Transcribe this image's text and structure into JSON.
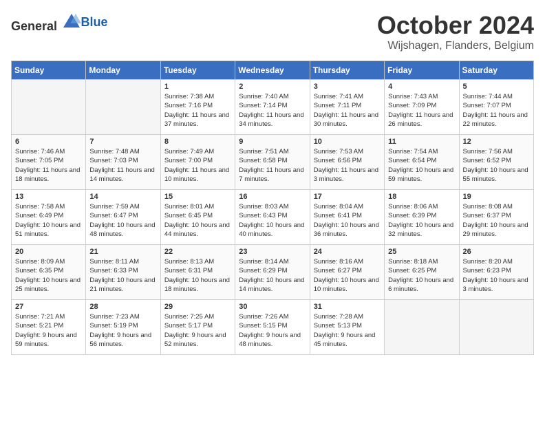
{
  "logo": {
    "text_general": "General",
    "text_blue": "Blue"
  },
  "title": {
    "month": "October 2024",
    "location": "Wijshagen, Flanders, Belgium"
  },
  "headers": [
    "Sunday",
    "Monday",
    "Tuesday",
    "Wednesday",
    "Thursday",
    "Friday",
    "Saturday"
  ],
  "weeks": [
    [
      {
        "day": "",
        "empty": true
      },
      {
        "day": "",
        "empty": true
      },
      {
        "day": "1",
        "sunrise": "Sunrise: 7:38 AM",
        "sunset": "Sunset: 7:16 PM",
        "daylight": "Daylight: 11 hours and 37 minutes."
      },
      {
        "day": "2",
        "sunrise": "Sunrise: 7:40 AM",
        "sunset": "Sunset: 7:14 PM",
        "daylight": "Daylight: 11 hours and 34 minutes."
      },
      {
        "day": "3",
        "sunrise": "Sunrise: 7:41 AM",
        "sunset": "Sunset: 7:11 PM",
        "daylight": "Daylight: 11 hours and 30 minutes."
      },
      {
        "day": "4",
        "sunrise": "Sunrise: 7:43 AM",
        "sunset": "Sunset: 7:09 PM",
        "daylight": "Daylight: 11 hours and 26 minutes."
      },
      {
        "day": "5",
        "sunrise": "Sunrise: 7:44 AM",
        "sunset": "Sunset: 7:07 PM",
        "daylight": "Daylight: 11 hours and 22 minutes."
      }
    ],
    [
      {
        "day": "6",
        "sunrise": "Sunrise: 7:46 AM",
        "sunset": "Sunset: 7:05 PM",
        "daylight": "Daylight: 11 hours and 18 minutes."
      },
      {
        "day": "7",
        "sunrise": "Sunrise: 7:48 AM",
        "sunset": "Sunset: 7:03 PM",
        "daylight": "Daylight: 11 hours and 14 minutes."
      },
      {
        "day": "8",
        "sunrise": "Sunrise: 7:49 AM",
        "sunset": "Sunset: 7:00 PM",
        "daylight": "Daylight: 11 hours and 10 minutes."
      },
      {
        "day": "9",
        "sunrise": "Sunrise: 7:51 AM",
        "sunset": "Sunset: 6:58 PM",
        "daylight": "Daylight: 11 hours and 7 minutes."
      },
      {
        "day": "10",
        "sunrise": "Sunrise: 7:53 AM",
        "sunset": "Sunset: 6:56 PM",
        "daylight": "Daylight: 11 hours and 3 minutes."
      },
      {
        "day": "11",
        "sunrise": "Sunrise: 7:54 AM",
        "sunset": "Sunset: 6:54 PM",
        "daylight": "Daylight: 10 hours and 59 minutes."
      },
      {
        "day": "12",
        "sunrise": "Sunrise: 7:56 AM",
        "sunset": "Sunset: 6:52 PM",
        "daylight": "Daylight: 10 hours and 55 minutes."
      }
    ],
    [
      {
        "day": "13",
        "sunrise": "Sunrise: 7:58 AM",
        "sunset": "Sunset: 6:49 PM",
        "daylight": "Daylight: 10 hours and 51 minutes."
      },
      {
        "day": "14",
        "sunrise": "Sunrise: 7:59 AM",
        "sunset": "Sunset: 6:47 PM",
        "daylight": "Daylight: 10 hours and 48 minutes."
      },
      {
        "day": "15",
        "sunrise": "Sunrise: 8:01 AM",
        "sunset": "Sunset: 6:45 PM",
        "daylight": "Daylight: 10 hours and 44 minutes."
      },
      {
        "day": "16",
        "sunrise": "Sunrise: 8:03 AM",
        "sunset": "Sunset: 6:43 PM",
        "daylight": "Daylight: 10 hours and 40 minutes."
      },
      {
        "day": "17",
        "sunrise": "Sunrise: 8:04 AM",
        "sunset": "Sunset: 6:41 PM",
        "daylight": "Daylight: 10 hours and 36 minutes."
      },
      {
        "day": "18",
        "sunrise": "Sunrise: 8:06 AM",
        "sunset": "Sunset: 6:39 PM",
        "daylight": "Daylight: 10 hours and 32 minutes."
      },
      {
        "day": "19",
        "sunrise": "Sunrise: 8:08 AM",
        "sunset": "Sunset: 6:37 PM",
        "daylight": "Daylight: 10 hours and 29 minutes."
      }
    ],
    [
      {
        "day": "20",
        "sunrise": "Sunrise: 8:09 AM",
        "sunset": "Sunset: 6:35 PM",
        "daylight": "Daylight: 10 hours and 25 minutes."
      },
      {
        "day": "21",
        "sunrise": "Sunrise: 8:11 AM",
        "sunset": "Sunset: 6:33 PM",
        "daylight": "Daylight: 10 hours and 21 minutes."
      },
      {
        "day": "22",
        "sunrise": "Sunrise: 8:13 AM",
        "sunset": "Sunset: 6:31 PM",
        "daylight": "Daylight: 10 hours and 18 minutes."
      },
      {
        "day": "23",
        "sunrise": "Sunrise: 8:14 AM",
        "sunset": "Sunset: 6:29 PM",
        "daylight": "Daylight: 10 hours and 14 minutes."
      },
      {
        "day": "24",
        "sunrise": "Sunrise: 8:16 AM",
        "sunset": "Sunset: 6:27 PM",
        "daylight": "Daylight: 10 hours and 10 minutes."
      },
      {
        "day": "25",
        "sunrise": "Sunrise: 8:18 AM",
        "sunset": "Sunset: 6:25 PM",
        "daylight": "Daylight: 10 hours and 6 minutes."
      },
      {
        "day": "26",
        "sunrise": "Sunrise: 8:20 AM",
        "sunset": "Sunset: 6:23 PM",
        "daylight": "Daylight: 10 hours and 3 minutes."
      }
    ],
    [
      {
        "day": "27",
        "sunrise": "Sunrise: 7:21 AM",
        "sunset": "Sunset: 5:21 PM",
        "daylight": "Daylight: 9 hours and 59 minutes."
      },
      {
        "day": "28",
        "sunrise": "Sunrise: 7:23 AM",
        "sunset": "Sunset: 5:19 PM",
        "daylight": "Daylight: 9 hours and 56 minutes."
      },
      {
        "day": "29",
        "sunrise": "Sunrise: 7:25 AM",
        "sunset": "Sunset: 5:17 PM",
        "daylight": "Daylight: 9 hours and 52 minutes."
      },
      {
        "day": "30",
        "sunrise": "Sunrise: 7:26 AM",
        "sunset": "Sunset: 5:15 PM",
        "daylight": "Daylight: 9 hours and 48 minutes."
      },
      {
        "day": "31",
        "sunrise": "Sunrise: 7:28 AM",
        "sunset": "Sunset: 5:13 PM",
        "daylight": "Daylight: 9 hours and 45 minutes."
      },
      {
        "day": "",
        "empty": true
      },
      {
        "day": "",
        "empty": true
      }
    ]
  ]
}
